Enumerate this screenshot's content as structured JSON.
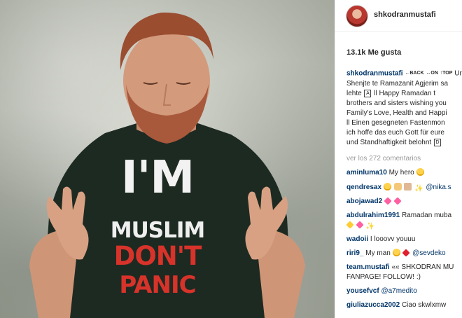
{
  "post": {
    "shirt": {
      "line1": "I'M",
      "line2": "MUSLIM",
      "line3": "DON'T",
      "line4": "PANIC"
    }
  },
  "header": {
    "username": "shkodranmustafi"
  },
  "likes": "13.1k Me gusta",
  "caption": {
    "author": "shkodranmustafi",
    "sym_back": "BACK",
    "sym_on": "ON",
    "sym_top": "TOP",
    "line1_text": "Urim",
    "line2": "Shenjte te Ramazanit Agjerim sa",
    "line3_a": "lehte",
    "line3_box": "A",
    "line3_b": "ll Happy Ramadan t",
    "line4": "brothers and sisters wishing you",
    "line5": "Family's Love, Health and Happi",
    "line6": "ll Einen gesegneten Fastenmon",
    "line7": "ich hoffe das euch Gott für eure",
    "line8_a": "und Standhaftigkeit belohnt",
    "line8_box": "D"
  },
  "view_comments": "ver los 272 comentarios",
  "comments": [
    {
      "user": "aminluma10",
      "text": "My hero"
    },
    {
      "user": "qendresax",
      "text": "@nika.s"
    },
    {
      "user": "abojawad2",
      "text": ""
    },
    {
      "user": "abdulrahim1991",
      "text": "Ramadan muba"
    },
    {
      "user": "wadoii",
      "text": "I looovv youuu"
    },
    {
      "user": "riri9_",
      "text": "My man",
      "mention": "@sevdeko"
    },
    {
      "user": "team.mustafi",
      "text": "«« SHKODRAN MU",
      "text2": "FANPAGE! FOLLOW! :)"
    },
    {
      "user": "yousefvcf",
      "text": "@a7medito"
    },
    {
      "user": "giuliazucca2002",
      "text": "Ciao skwlxmw"
    }
  ],
  "colors": {
    "link": "#003569",
    "muted": "#999999",
    "shirt_red": "#d8332a",
    "shirt_dark": "#1d2a22"
  },
  "icons": {
    "avatar": "profile-avatar",
    "emoji_sun": "smiling-face-sunglasses-icon",
    "emoji_heart": "heart-icon"
  }
}
